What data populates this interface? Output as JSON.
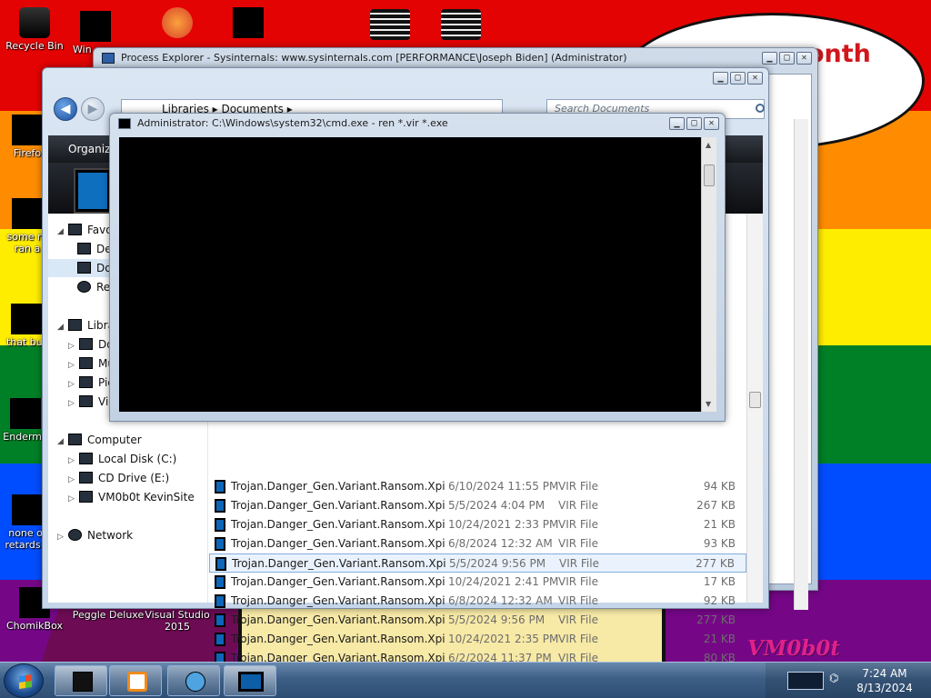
{
  "wallpaper": {
    "stripes": [
      "#e40303",
      "#ff8c00",
      "#ffed00",
      "#008026",
      "#004dff",
      "#750787"
    ],
    "cloud_text": "onth",
    "watermark": "VM0b0t"
  },
  "desktop_icons": [
    {
      "label": "Recycle Bin",
      "icon": "recycle-bin-icon"
    },
    {
      "label": "Win",
      "icon": "app-icon"
    },
    {
      "label": "Firefo",
      "icon": "firefox-icon"
    },
    {
      "label": "some ru",
      "label2": "ran a",
      "icon": "folder-icon"
    },
    {
      "label": "that but",
      "icon": "file-icon"
    },
    {
      "label": "Enderma",
      "icon": "app-icon"
    },
    {
      "label": "none of",
      "label2": "retards k",
      "icon": "file-icon"
    },
    {
      "label": "ChomikBox",
      "icon": "app-icon"
    },
    {
      "label": "Peggle Deluxe",
      "icon": "game-icon"
    },
    {
      "label": "Visual Studio",
      "label2": "2015",
      "icon": "visual-studio-icon"
    }
  ],
  "process_explorer": {
    "title": "Process Explorer - Sysinternals: www.sysinternals.com [PERFORMANCE\\Joseph Biden] (Administrator)"
  },
  "explorer": {
    "address": "Libraries  ▸  Documents  ▸",
    "search_placeholder": "Search Documents",
    "organize_label": "Organize",
    "nav": {
      "favorites": "Favo",
      "fav_items": [
        "De",
        "Do",
        "Re"
      ],
      "libraries": "Libra",
      "lib_items": [
        "Do",
        "Mu",
        "Pic",
        "Vid"
      ],
      "computer": "Computer",
      "drives": [
        "Local Disk (C:)",
        "CD Drive (E:)",
        "VM0b0t KevinSite"
      ],
      "network": "Network"
    },
    "files": [
      {
        "name": "Trojan.Danger_Gen.Variant.Ransom.Xpir...",
        "date": "6/10/2024 11:55 PM",
        "type": "VIR File",
        "size": "94 KB"
      },
      {
        "name": "Trojan.Danger_Gen.Variant.Ransom.Xpir...",
        "date": "5/5/2024 4:04 PM",
        "type": "VIR File",
        "size": "267 KB"
      },
      {
        "name": "Trojan.Danger_Gen.Variant.Ransom.Xpir...",
        "date": "10/24/2021 2:33 PM",
        "type": "VIR File",
        "size": "21 KB"
      },
      {
        "name": "Trojan.Danger_Gen.Variant.Ransom.Xpir...",
        "date": "6/8/2024 12:32 AM",
        "type": "VIR File",
        "size": "93 KB"
      },
      {
        "name": "Trojan.Danger_Gen.Variant.Ransom.Xpir...",
        "date": "5/5/2024 9:56 PM",
        "type": "VIR File",
        "size": "277 KB",
        "selected": true
      },
      {
        "name": "Trojan.Danger_Gen.Variant.Ransom.Xpir...",
        "date": "10/24/2021 2:41 PM",
        "type": "VIR File",
        "size": "17 KB"
      },
      {
        "name": "Trojan.Danger_Gen.Variant.Ransom.Xpir...",
        "date": "6/8/2024 12:32 AM",
        "type": "VIR File",
        "size": "92 KB"
      },
      {
        "name": "Trojan.Danger_Gen.Variant.Ransom.Xpir...",
        "date": "5/5/2024 9:56 PM",
        "type": "VIR File",
        "size": "277 KB"
      },
      {
        "name": "Trojan.Danger_Gen.Variant.Ransom.Xpir...",
        "date": "10/24/2021 2:35 PM",
        "type": "VIR File",
        "size": "21 KB"
      },
      {
        "name": "Trojan.Danger_Gen.Variant.Ransom.Xpir...",
        "date": "6/2/2024 11:37 PM",
        "type": "VIR File",
        "size": "80 KB"
      }
    ]
  },
  "cmd": {
    "title": "Administrator: C:\\Windows\\system32\\cmd.exe - ren  *.vir *.exe"
  },
  "window_controls": {
    "minimize": "▁",
    "maximize": "□",
    "close": "✕"
  },
  "taskbar": {
    "buttons": [
      "explorer-icon",
      "media-player-icon",
      "search-icon",
      "cmd-icon"
    ],
    "clock_time": "7:24 AM",
    "clock_date": "8/13/2024"
  }
}
